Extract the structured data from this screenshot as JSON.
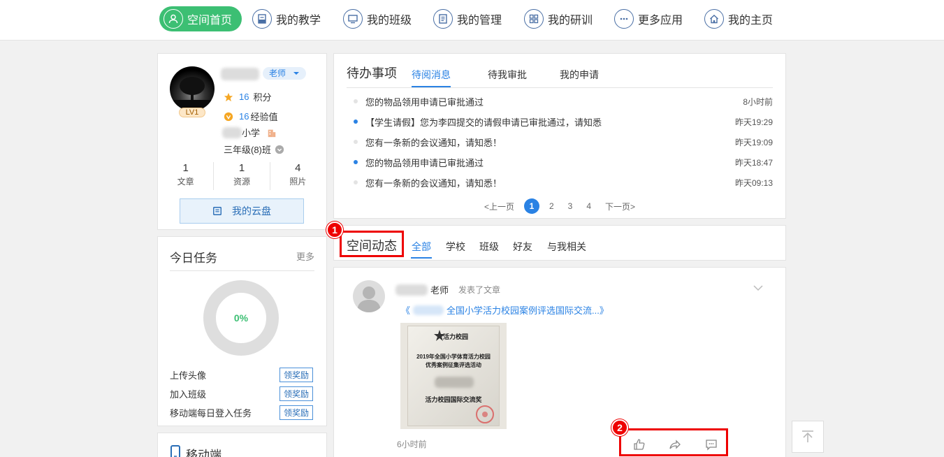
{
  "nav": {
    "items": [
      {
        "label": "空间首页",
        "icon": "user-icon",
        "active": true
      },
      {
        "label": "我的教学",
        "icon": "book-icon"
      },
      {
        "label": "我的班级",
        "icon": "monitor-icon"
      },
      {
        "label": "我的管理",
        "icon": "document-icon"
      },
      {
        "label": "我的研训",
        "icon": "grid-icon"
      },
      {
        "label": "更多应用",
        "icon": "more-icon"
      },
      {
        "label": "我的主页",
        "icon": "home-icon"
      }
    ]
  },
  "profile": {
    "role": "老师",
    "level": "LV1",
    "points_value": "16",
    "points_label": "积分",
    "exp_value": "16",
    "exp_label": "经验值",
    "school_suffix": "小学",
    "class_name": "三年级(8)班",
    "counts": [
      {
        "value": "1",
        "label": "文章"
      },
      {
        "value": "1",
        "label": "资源"
      },
      {
        "value": "4",
        "label": "照片"
      }
    ],
    "cloud_button": "我的云盘"
  },
  "tasks": {
    "title": "今日任务",
    "more": "更多",
    "progress_label": "0%",
    "progress": 0,
    "items": [
      {
        "name": "上传头像",
        "action": "领奖励"
      },
      {
        "name": "加入班级",
        "action": "领奖励"
      },
      {
        "name": "移动端每日登入任务",
        "action": "领奖励"
      }
    ]
  },
  "mobile": {
    "title": "移动端"
  },
  "todo": {
    "title": "待办事项",
    "tabs": [
      "待阅消息",
      "待我审批",
      "我的申请"
    ],
    "messages": [
      {
        "text": "您的物品领用申请已审批通过",
        "time": "8小时前",
        "unread": false
      },
      {
        "text": "【学生请假】您为李四提交的请假申请已审批通过，请知悉",
        "time": "昨天19:29",
        "unread": true
      },
      {
        "text": "您有一条新的会议通知，请知悉！",
        "time": "昨天19:09",
        "unread": false
      },
      {
        "text": "您的物品领用申请已审批通过",
        "time": "昨天18:47",
        "unread": true
      },
      {
        "text": "您有一条新的会议通知，请知悉！",
        "time": "昨天09:13",
        "unread": false
      }
    ],
    "pager": {
      "prev": "<上一页",
      "pages": [
        "1",
        "2",
        "3",
        "4"
      ],
      "next": "下一页>"
    }
  },
  "feed": {
    "title": "空间动态",
    "tabs": [
      "全部",
      "学校",
      "班级",
      "好友",
      "与我相关"
    ],
    "marker1": "1",
    "marker2": "2"
  },
  "post": {
    "author_suffix": "老师",
    "action": "发表了文章",
    "link_prefix": "《",
    "link_text": "全国小学活力校园案例评选国际交流...》",
    "time": "6小时前",
    "image_text": {
      "logo": "活力校园",
      "line1": "2019年全国小学体育活力校园",
      "line2": "优秀案例征集评选活动",
      "award": "活力校园国际交流奖"
    }
  }
}
